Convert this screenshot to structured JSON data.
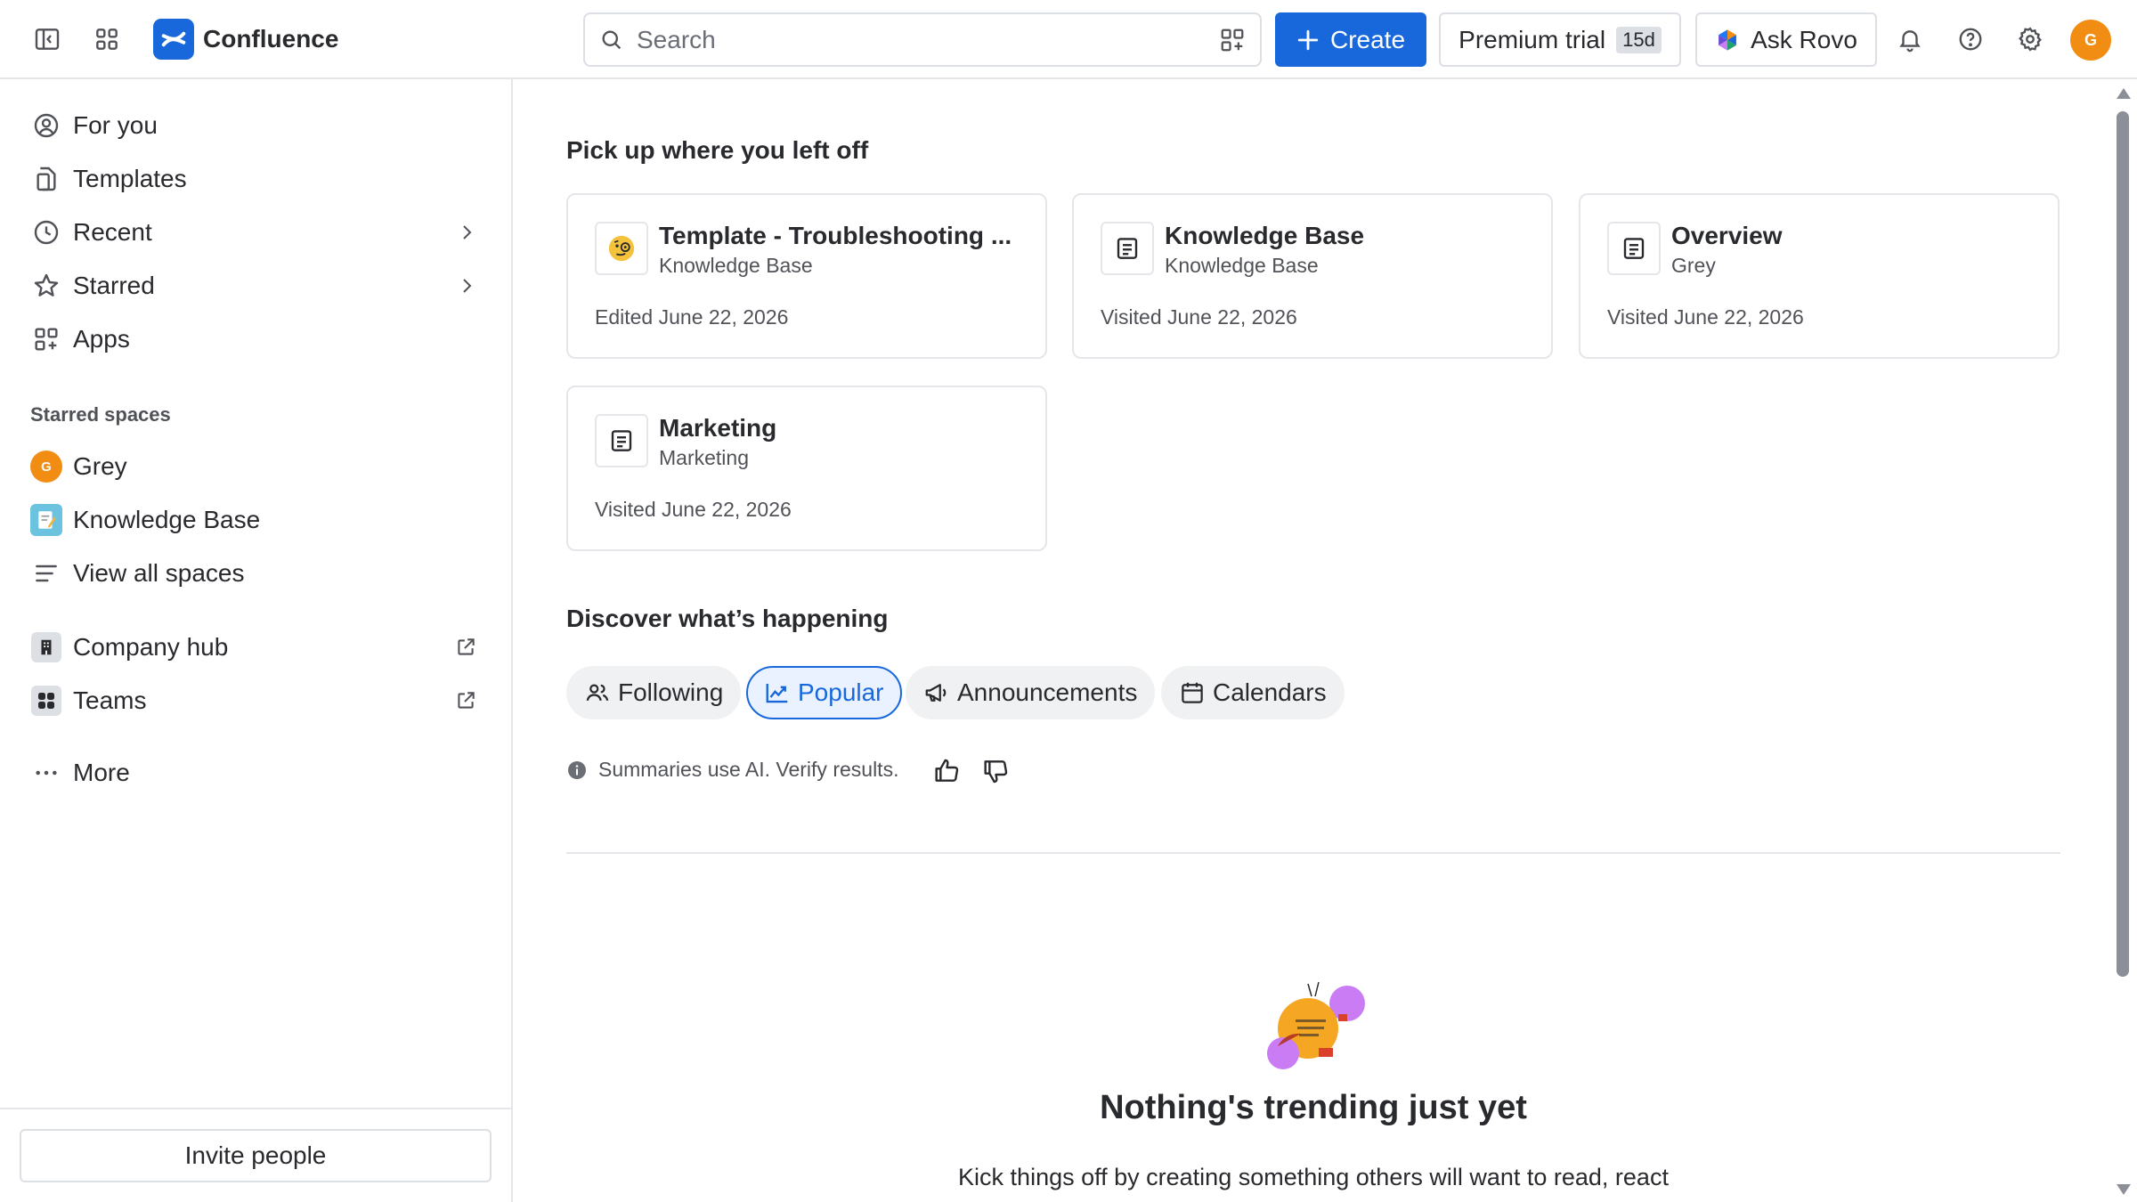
{
  "app": {
    "name": "Confluence",
    "brand_color": "#1868db"
  },
  "topbar": {
    "search_placeholder": "Search",
    "create_label": "Create",
    "premium_label": "Premium trial",
    "premium_badge": "15d",
    "rovo_label": "Ask Rovo",
    "avatar_initial": "G"
  },
  "sidebar": {
    "nav": [
      {
        "label": "For you",
        "icon": "user-circle-icon"
      },
      {
        "label": "Templates",
        "icon": "templates-icon"
      },
      {
        "label": "Recent",
        "icon": "clock-icon"
      },
      {
        "label": "Starred",
        "icon": "star-icon"
      },
      {
        "label": "Apps",
        "icon": "apps-icon"
      }
    ],
    "starred_heading": "Starred spaces",
    "spaces": [
      {
        "label": "Grey",
        "avatar": "G"
      },
      {
        "label": "Knowledge Base"
      }
    ],
    "view_all": "View all spaces",
    "links": [
      {
        "label": "Company hub"
      },
      {
        "label": "Teams"
      }
    ],
    "more": "More",
    "invite": "Invite people"
  },
  "main": {
    "recent_title": "Pick up where you left off",
    "cards": [
      {
        "title": "Template - Troubleshooting ...",
        "space": "Knowledge Base",
        "meta": "Edited June 22, 2026"
      },
      {
        "title": "Knowledge Base",
        "space": "Knowledge Base",
        "meta": "Visited June 22, 2026"
      },
      {
        "title": "Overview",
        "space": "Grey",
        "meta": "Visited June 22, 2026"
      },
      {
        "title": "Marketing",
        "space": "Marketing",
        "meta": "Visited June 22, 2026"
      }
    ],
    "discover_title": "Discover what’s happening",
    "chips": [
      {
        "label": "Following",
        "active": false
      },
      {
        "label": "Popular",
        "active": true
      },
      {
        "label": "Announcements",
        "active": false
      },
      {
        "label": "Calendars",
        "active": false
      }
    ],
    "ai_note": "Summaries use AI. Verify results.",
    "empty_title": "Nothing's trending just yet",
    "empty_body": "Kick things off by creating something others will want to read, react"
  }
}
